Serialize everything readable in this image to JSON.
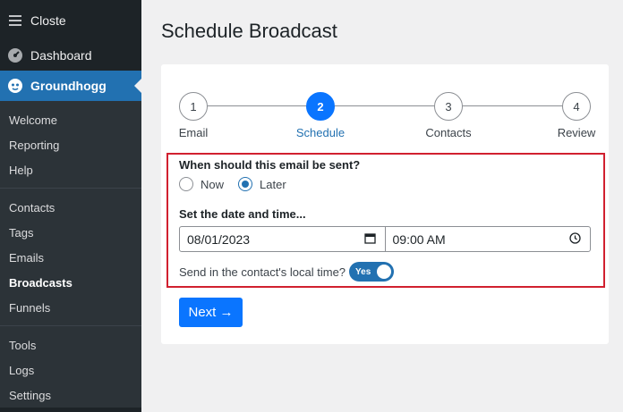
{
  "sidebar": {
    "top_item": {
      "label": "Closte",
      "icon": "menu-icon"
    },
    "dashboard": {
      "label": "Dashboard",
      "icon": "dashboard-gauge-icon"
    },
    "plugin": {
      "label": "Groundhogg",
      "icon": "groundhogg-logo-icon"
    },
    "group1": [
      {
        "label": "Welcome"
      },
      {
        "label": "Reporting"
      },
      {
        "label": "Help"
      }
    ],
    "group2": [
      {
        "label": "Contacts"
      },
      {
        "label": "Tags"
      },
      {
        "label": "Emails"
      },
      {
        "label": "Broadcasts",
        "current": true
      },
      {
        "label": "Funnels"
      }
    ],
    "group3": [
      {
        "label": "Tools"
      },
      {
        "label": "Logs"
      },
      {
        "label": "Settings"
      }
    ]
  },
  "page": {
    "title": "Schedule Broadcast"
  },
  "stepper": {
    "steps": [
      {
        "number": "1",
        "label": "Email"
      },
      {
        "number": "2",
        "label": "Schedule",
        "active": true
      },
      {
        "number": "3",
        "label": "Contacts"
      },
      {
        "number": "4",
        "label": "Review"
      }
    ]
  },
  "schedule": {
    "question": "When should this email be sent?",
    "options": [
      {
        "label": "Now",
        "checked": false
      },
      {
        "label": "Later",
        "checked": true
      }
    ],
    "datetime_label": "Set the date and time...",
    "date_value": "08/01/2023",
    "time_value": "09:00 AM",
    "local_time_label": "Send in the contact's local time?",
    "local_time_toggle": "Yes"
  },
  "actions": {
    "next_label": "Next →"
  },
  "colors": {
    "sidebar_bg": "#1d2327",
    "accent": "#2271b1",
    "button": "#0a75ff",
    "highlight": "#d1202f"
  }
}
